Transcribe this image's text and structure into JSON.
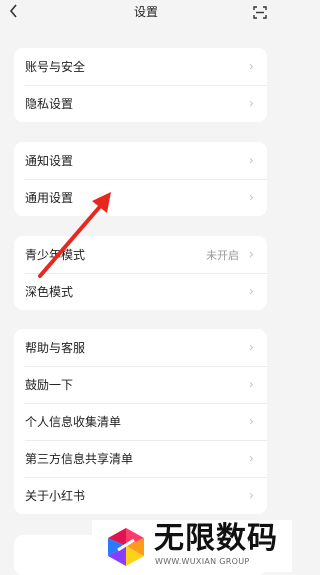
{
  "header": {
    "title": "设置",
    "back_icon": "chevron-left-icon",
    "scan_icon": "scan-icon"
  },
  "groups": [
    {
      "items": [
        {
          "label": "账号与安全"
        },
        {
          "label": "隐私设置"
        }
      ]
    },
    {
      "items": [
        {
          "label": "通知设置"
        },
        {
          "label": "通用设置"
        }
      ]
    },
    {
      "items": [
        {
          "label": "青少年模式",
          "value": "未开启"
        },
        {
          "label": "深色模式"
        }
      ]
    },
    {
      "items": [
        {
          "label": "帮助与客服"
        },
        {
          "label": "鼓励一下"
        },
        {
          "label": "个人信息收集清单"
        },
        {
          "label": "第三方信息共享清单"
        },
        {
          "label": "关于小红书"
        }
      ]
    }
  ],
  "annotation": {
    "arrow_color": "#e8281e"
  },
  "watermark": {
    "title": "无限数码",
    "subtitle": "WWW.WUXIAN GROUP"
  },
  "colors": {
    "background": "#f4f4f5",
    "card": "#ffffff",
    "text": "#222222",
    "chevron": "#c2c2c2"
  }
}
